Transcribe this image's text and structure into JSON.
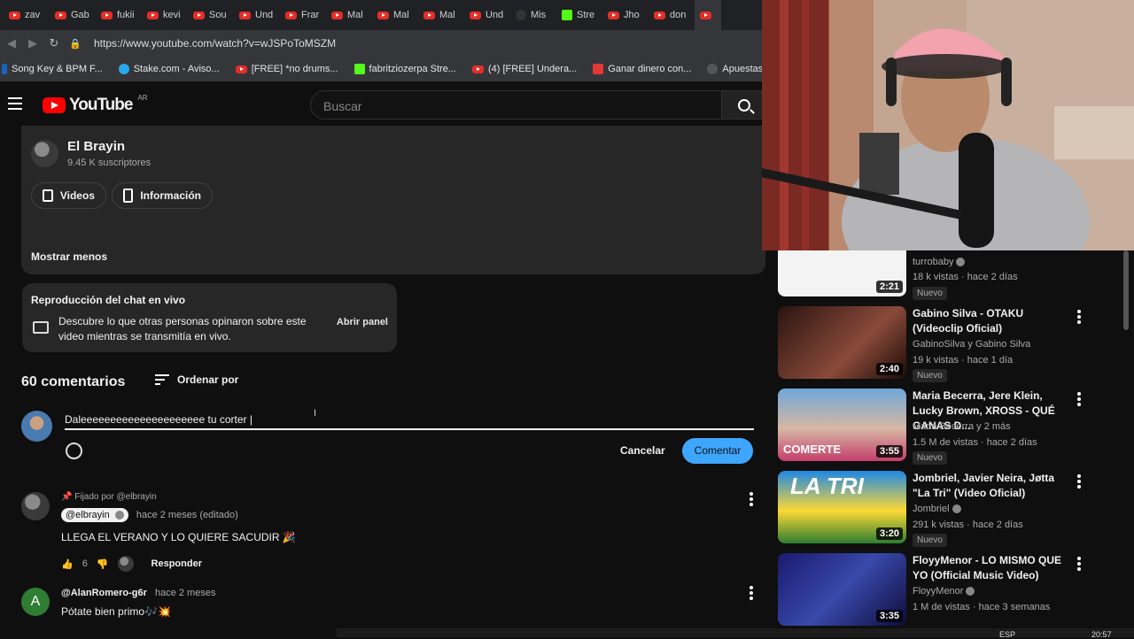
{
  "browser": {
    "tabs": [
      "zav",
      "Gab",
      "fukii",
      "kevi",
      "Sou",
      "Und",
      "Frar",
      "Mal",
      "Mal",
      "Mal",
      "Und",
      "Mis",
      "Stre",
      "Jho",
      "don"
    ],
    "url": "https://www.youtube.com/watch?v=wJSPoToMSZM",
    "bookmarks": [
      "Song Key & BPM F...",
      "Stake.com - Aviso...",
      "[FREE] *no drums...",
      "fabritziozerpa Stre...",
      "(4) [FREE] Undera...",
      "Ganar dinero con...",
      "Apuestas"
    ]
  },
  "youtube": {
    "logo_text": "YouTube",
    "region": "AR",
    "search_placeholder": "Buscar"
  },
  "channel": {
    "name": "El Brayin",
    "subscribers": "9.45 K suscriptores",
    "videos_label": "Videos",
    "info_label": "Información",
    "show_less": "Mostrar menos"
  },
  "live_chat": {
    "title": "Reproducción del chat en vivo",
    "description": "Descubre lo que otras personas opinaron sobre este video mientras se transmitía en vivo.",
    "open_label": "Abrir panel"
  },
  "comments": {
    "count": "60 comentarios",
    "sort_label": "Ordenar por",
    "draft": "Daleeeeeeeeeeeeeeeeeeeee tu corter |",
    "cancel_label": "Cancelar",
    "submit_label": "Comentar",
    "items": [
      {
        "pinned": "Fijado por @elbrayin",
        "author": "@elbrayin",
        "time": "hace 2 meses (editado)",
        "text": "LLEGA EL VERANO Y LO QUIERE SACUDIR 🎉",
        "likes": "6",
        "reply": "Responder"
      },
      {
        "author": "@AlanRomero-g6r",
        "time": "hace 2 meses",
        "text": "Pótate bien primo🎶💥",
        "initial": "A"
      }
    ]
  },
  "sidebar": [
    {
      "title": "",
      "channel": "turrobaby",
      "meta": "18 k vistas · hace 2 días",
      "badge": "Nuevo",
      "duration": "2:21"
    },
    {
      "title": "Gabino Silva - OTAKU (Videoclip Oficial)",
      "channel": "GabinoSilva y Gabino Silva",
      "meta": "19 k vistas · hace 1 día",
      "badge": "Nuevo",
      "duration": "2:40"
    },
    {
      "title": "Maria Becerra, Jere Klein, Lucky Brown, XROSS - QUÉ GANAS D...",
      "channel": "Maria Becerra y 2 más",
      "meta": "1.5 M de vistas · hace 2 días",
      "badge": "Nuevo",
      "duration": "3:55",
      "thumb_text": "COMERTE"
    },
    {
      "title": "Jombriel, Javier Neira, Jøtta \"La Tri\" (Video Oficial)",
      "channel": "Jombriel",
      "meta": "291 k vistas · hace 2 días",
      "badge": "Nuevo",
      "duration": "3:20",
      "thumb_text": "LA TRI"
    },
    {
      "title": "FloyyMenor - LO MISMO QUE YO (Official Music Video)",
      "channel": "FloyyMenor",
      "meta": "1 M de vistas · hace 3 semanas",
      "duration": "3:35"
    }
  ],
  "taskbar": {
    "lang": "ESP",
    "clock": "20:57"
  }
}
